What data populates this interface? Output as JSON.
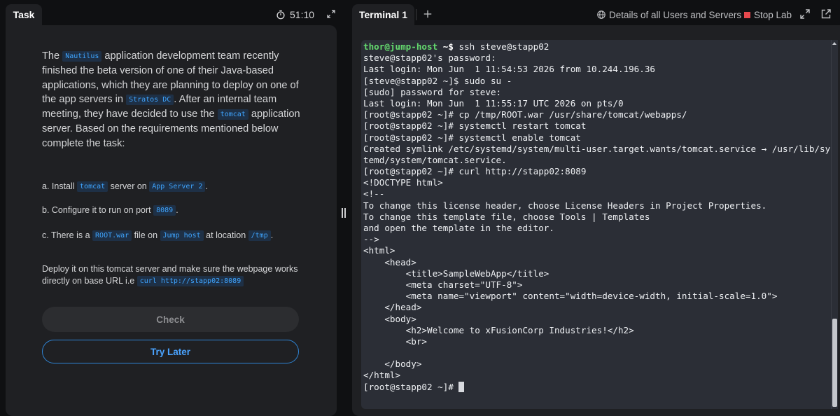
{
  "task_tab": {
    "label": "Task"
  },
  "timer": {
    "value": "51:10"
  },
  "task": {
    "intro": [
      {
        "text": "The "
      },
      {
        "code": "Nautilus"
      },
      {
        "text": " application development team recently finished the beta version of one of their Java-based applications, which they are planning to deploy on one of the app servers in "
      },
      {
        "code": "Stratos DC"
      },
      {
        "text": ". After an internal team meeting, they have decided to use the "
      },
      {
        "code": "tomcat"
      },
      {
        "text": " application server. Based on the requirements mentioned below complete the task:"
      }
    ],
    "req_a": [
      {
        "text": "a. Install "
      },
      {
        "code": "tomcat"
      },
      {
        "text": " server on "
      },
      {
        "code": "App Server 2"
      },
      {
        "text": "."
      }
    ],
    "req_b": [
      {
        "text": "b. Configure it to run on port "
      },
      {
        "code": "8089"
      },
      {
        "text": "."
      }
    ],
    "req_c": [
      {
        "text": "c. There is a "
      },
      {
        "code": "ROOT.war"
      },
      {
        "text": " file on "
      },
      {
        "code": "Jump host"
      },
      {
        "text": " at location "
      },
      {
        "code": "/tmp"
      },
      {
        "text": "."
      }
    ],
    "deploy": [
      {
        "text": "Deploy it on this tomcat server and make sure the webpage works directly on base URL i.e "
      },
      {
        "code": "curl http://stapp02:8089"
      }
    ],
    "check_label": "Check",
    "try_later_label": "Try Later"
  },
  "terminal_tab": {
    "label": "Terminal 1"
  },
  "header": {
    "details_label": "Details of all Users and Servers",
    "stop_lab_label": "Stop Lab"
  },
  "terminal": {
    "lines": [
      {
        "user": "thor@jump-host",
        "path": " ~$",
        "cmd": " ssh steve@stapp02"
      },
      {
        "text": "steve@stapp02's password:"
      },
      {
        "text": "Last login: Mon Jun  1 11:54:53 2026 from 10.244.196.36"
      },
      {
        "text": "[steve@stapp02 ~]$ sudo su -"
      },
      {
        "text": "[sudo] password for steve:"
      },
      {
        "text": "Last login: Mon Jun  1 11:55:17 UTC 2026 on pts/0"
      },
      {
        "text": "[root@stapp02 ~]# cp /tmp/ROOT.war /usr/share/tomcat/webapps/"
      },
      {
        "text": "[root@stapp02 ~]# systemctl restart tomcat"
      },
      {
        "text": "[root@stapp02 ~]# systemctl enable tomcat"
      },
      {
        "text": "Created symlink /etc/systemd/system/multi-user.target.wants/tomcat.service → /usr/lib/sys"
      },
      {
        "text": "temd/system/tomcat.service."
      },
      {
        "text": "[root@stapp02 ~]# curl http://stapp02:8089"
      },
      {
        "text": "<!DOCTYPE html>"
      },
      {
        "text": "<!--"
      },
      {
        "text": "To change this license header, choose License Headers in Project Properties."
      },
      {
        "text": "To change this template file, choose Tools | Templates"
      },
      {
        "text": "and open the template in the editor."
      },
      {
        "text": "-->"
      },
      {
        "text": "<html>"
      },
      {
        "text": "    <head>"
      },
      {
        "text": "        <title>SampleWebApp</title>"
      },
      {
        "text": "        <meta charset=\"UTF-8\">"
      },
      {
        "text": "        <meta name=\"viewport\" content=\"width=device-width, initial-scale=1.0\">"
      },
      {
        "text": "    </head>"
      },
      {
        "text": "    <body>"
      },
      {
        "text": "        <h2>Welcome to xFusionCorp Industries!</h2>"
      },
      {
        "text": "        <br>"
      },
      {
        "text": ""
      },
      {
        "text": "    </body>"
      },
      {
        "text": "</html>"
      },
      {
        "text": "[root@stapp02 ~]# ",
        "cursor": true
      }
    ]
  },
  "colors": {
    "accent_blue": "#4aa3ff",
    "code_chip_bg": "#1e3046",
    "prompt_green": "#64d96e",
    "stop_red": "#e5484d",
    "terminal_bg": "#2b2e36",
    "panel_bg": "#1f2023"
  },
  "icons": [
    "stopwatch-icon",
    "expand-icon",
    "plus-icon",
    "globe-icon",
    "stop-square-icon",
    "fullscreen-icon",
    "external-link-icon"
  ]
}
